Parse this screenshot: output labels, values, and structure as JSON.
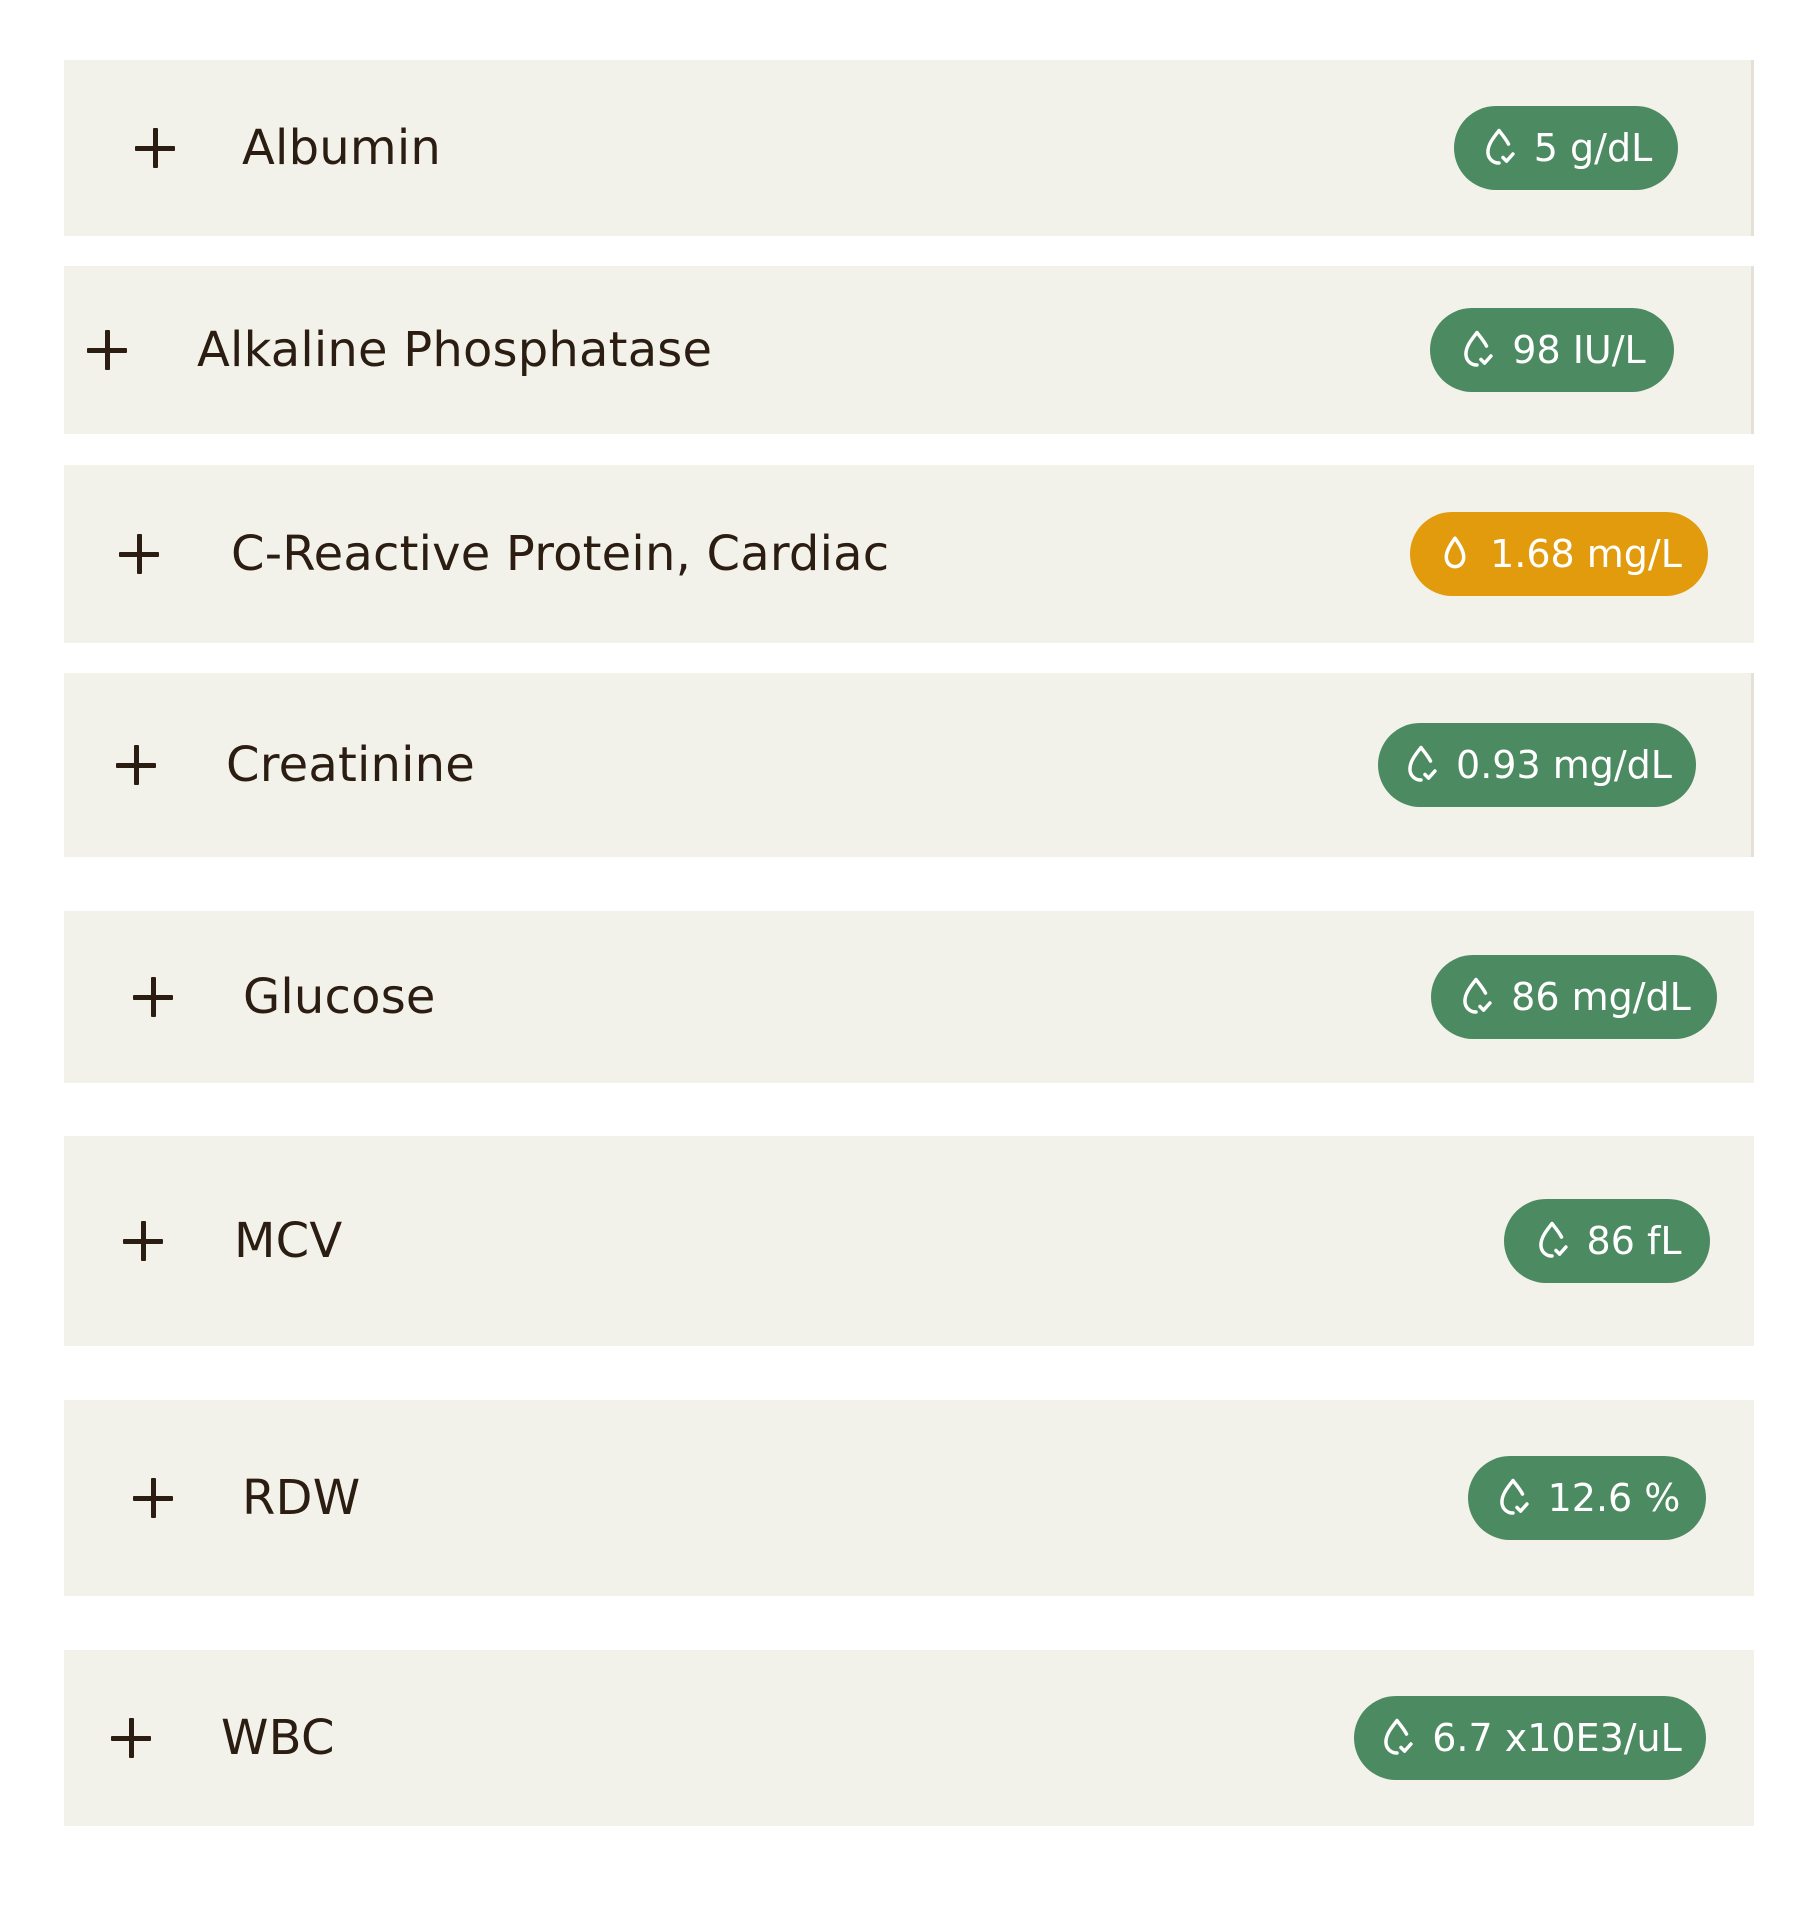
{
  "biomarkers": [
    {
      "name": "Albumin",
      "value": "5 g/dL",
      "status": "normal"
    },
    {
      "name": "Alkaline Phosphatase",
      "value": "98 IU/L",
      "status": "normal"
    },
    {
      "name": "C-Reactive Protein, Cardiac",
      "value": "1.68 mg/L",
      "status": "borderline"
    },
    {
      "name": "Creatinine",
      "value": "0.93 mg/dL",
      "status": "normal"
    },
    {
      "name": "Glucose",
      "value": "86 mg/dL",
      "status": "normal"
    },
    {
      "name": "MCV",
      "value": "86 fL",
      "status": "normal"
    },
    {
      "name": "RDW",
      "value": "12.6 %",
      "status": "normal"
    },
    {
      "name": "WBC",
      "value": "6.7 x10E3/uL",
      "status": "normal"
    }
  ],
  "icons": {
    "expand": "plus-icon",
    "normal": "drop-check-icon",
    "borderline": "drop-icon"
  },
  "colors": {
    "row_background": "#f3f2ea",
    "text": "#2b1d12",
    "normal_badge": "#4c8a61",
    "borderline_badge": "#e39b0e"
  }
}
